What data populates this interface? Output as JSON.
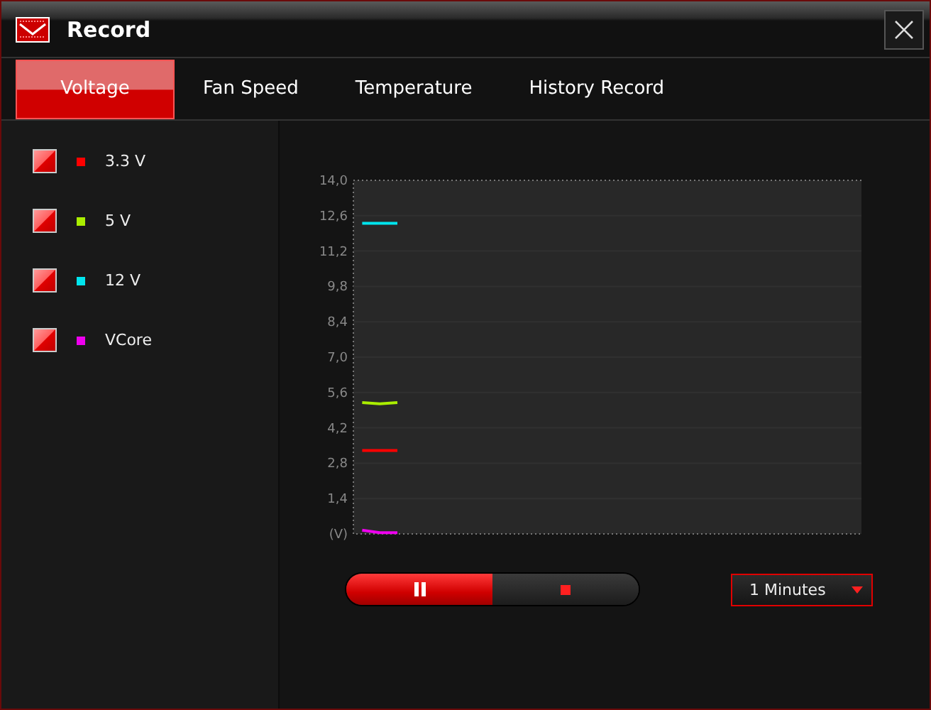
{
  "window": {
    "title": "Record"
  },
  "tabs": [
    {
      "label": "Voltage",
      "selected": true
    },
    {
      "label": "Fan Speed",
      "selected": false
    },
    {
      "label": "Temperature",
      "selected": false
    },
    {
      "label": "History Record",
      "selected": false
    }
  ],
  "sensors": [
    {
      "label": "3.3 V",
      "checked": true,
      "color": "#ff0000"
    },
    {
      "label": "5 V",
      "checked": true,
      "color": "#aaee00"
    },
    {
      "label": "12 V",
      "checked": true,
      "color": "#00e5ee"
    },
    {
      "label": "VCore",
      "checked": true,
      "color": "#ee00ee"
    }
  ],
  "chart": {
    "chart_data": {
      "type": "line",
      "grid": true,
      "categories": [
        null,
        null,
        null,
        null,
        null,
        null,
        null,
        null,
        null,
        null,
        null,
        null,
        null,
        null,
        null,
        null,
        null,
        null,
        null,
        null,
        null,
        null,
        null,
        null,
        null,
        null,
        null,
        null,
        null,
        null
      ],
      "ylim": [
        0,
        14
      ],
      "yticks": [
        {
          "value": 0,
          "label": "(V)"
        },
        {
          "value": 1.4,
          "label": "1,4"
        },
        {
          "value": 2.8,
          "label": "2,8"
        },
        {
          "value": 4.2,
          "label": "4,2"
        },
        {
          "value": 5.6,
          "label": "5,6"
        },
        {
          "value": 7,
          "label": "7,0"
        },
        {
          "value": 8.4,
          "label": "8,4"
        },
        {
          "value": 9.8,
          "label": "9,8"
        },
        {
          "value": 11.2,
          "label": "11,2"
        },
        {
          "value": 12.6,
          "label": "12,6"
        },
        {
          "value": 14,
          "label": "14,0"
        }
      ],
      "series": [
        {
          "color": "#ff0000",
          "values": [
            3.3,
            3.3,
            3.3,
            null,
            null,
            null,
            null,
            null,
            null,
            null,
            null,
            null,
            null,
            null,
            null,
            null,
            null,
            null,
            null,
            null,
            null,
            null,
            null,
            null,
            null,
            null,
            null,
            null,
            null,
            null
          ]
        },
        {
          "color": "#aaee00",
          "values": [
            5.2,
            5.15,
            5.2,
            null,
            null,
            null,
            null,
            null,
            null,
            null,
            null,
            null,
            null,
            null,
            null,
            null,
            null,
            null,
            null,
            null,
            null,
            null,
            null,
            null,
            null,
            null,
            null,
            null,
            null,
            null
          ]
        },
        {
          "color": "#00e5ee",
          "values": [
            12.3,
            12.3,
            12.3,
            null,
            null,
            null,
            null,
            null,
            null,
            null,
            null,
            null,
            null,
            null,
            null,
            null,
            null,
            null,
            null,
            null,
            null,
            null,
            null,
            null,
            null,
            null,
            null,
            null,
            null,
            null
          ]
        },
        {
          "color": "#ee00ee",
          "values": [
            0.15,
            0.05,
            0.05,
            null,
            null,
            null,
            null,
            null,
            null,
            null,
            null,
            null,
            null,
            null,
            null,
            null,
            null,
            null,
            null,
            null,
            null,
            null,
            null,
            null,
            null,
            null,
            null,
            null,
            null,
            null
          ]
        }
      ]
    }
  },
  "controls": [
    {
      "kind": "pause",
      "selected": true
    },
    {
      "kind": "stop",
      "selected": false
    }
  ],
  "interval": {
    "value": "1 Minutes"
  }
}
